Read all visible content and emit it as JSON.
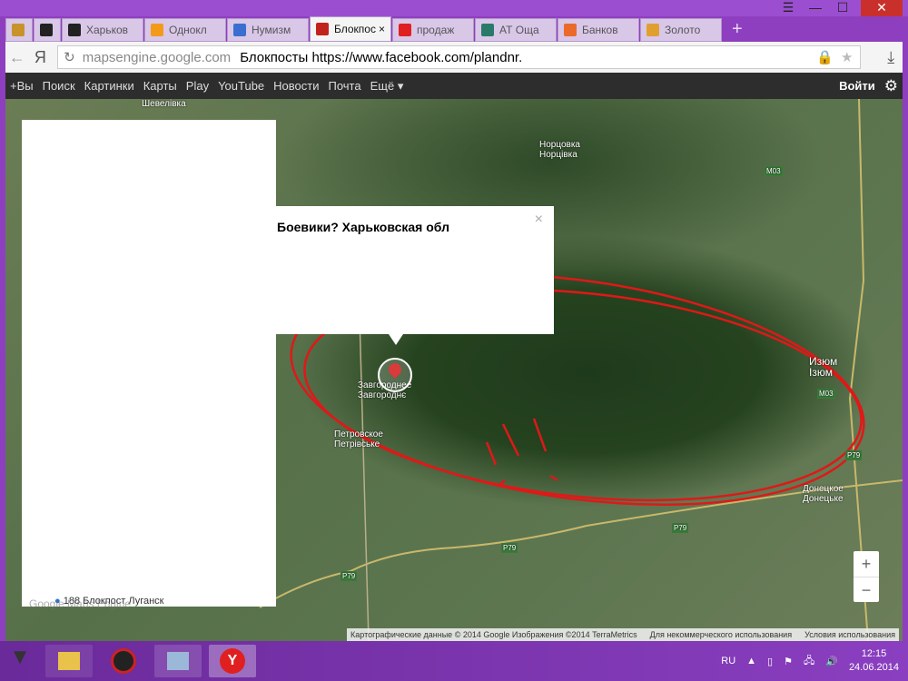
{
  "window": {
    "minimize": "—",
    "maximize": "☐",
    "close": "✕",
    "menu": "☰"
  },
  "tabs": [
    {
      "label": "",
      "color": "#c7932a"
    },
    {
      "label": "",
      "color": "#222"
    },
    {
      "label": "Харьков",
      "color": "#222"
    },
    {
      "label": "Однокл",
      "color": "#f39a1b"
    },
    {
      "label": "Нумизм",
      "color": "#3a6fd0"
    },
    {
      "label": "Блокпос",
      "color": "#c2221c",
      "active": true
    },
    {
      "label": "продаж",
      "color": "#e02020"
    },
    {
      "label": "АТ Оща",
      "color": "#2a7a6a"
    },
    {
      "label": "Банков",
      "color": "#ea6a2a"
    },
    {
      "label": "Золото",
      "color": "#e0a030"
    }
  ],
  "address": {
    "back": "←",
    "ya": "Я",
    "host": "mapsengine.google.com",
    "title": "Блокпосты https://www.facebook.com/plandnr.",
    "download": "⤓"
  },
  "gbar": {
    "items": [
      "+Вы",
      "Поиск",
      "Картинки",
      "Карты",
      "Play",
      "YouTube",
      "Новости",
      "Почта",
      "Ещё ▾"
    ],
    "login": "Войти"
  },
  "map": {
    "labels": [
      {
        "text": "Шевелівка"
      },
      {
        "text": "Норцовка\nНорцівка"
      },
      {
        "text": "Изюм\nІзюм"
      },
      {
        "text": "Завгороднее\nЗавгороднє"
      },
      {
        "text": "Петровское\nПетрівське"
      },
      {
        "text": "Донецкое\nДонецьке"
      },
      {
        "text": "M03"
      },
      {
        "text": "M03"
      },
      {
        "text": "P79"
      },
      {
        "text": "P79"
      },
      {
        "text": "P79"
      },
      {
        "text": "P79"
      }
    ],
    "popup_title": "Боевики? Харьковская обл",
    "popup_close": "×",
    "panel_item": "188 Блокпост Луганск",
    "logo": "Google Maps Engine",
    "zoom_in": "+",
    "zoom_out": "−",
    "attribution": [
      "Картографические данные © 2014 Google Изображения ©2014 TerraMetrics",
      "Для некоммерческого использования",
      "Условия использования"
    ]
  },
  "taskbar": {
    "lang": "RU",
    "time": "12:15",
    "date": "24.06.2014"
  }
}
